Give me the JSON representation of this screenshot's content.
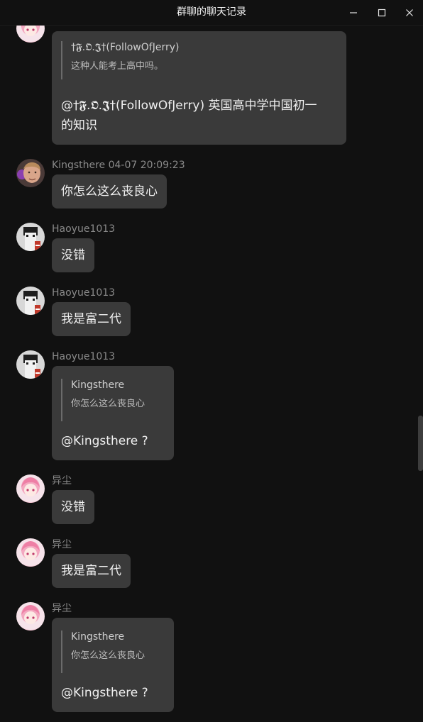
{
  "window": {
    "title": "群聊的聊天记录"
  },
  "messages": {
    "m0": {
      "quote": {
        "name": "†𝕱.𝕺.𝕵†(FollowOfJerry)",
        "text": "这种人能考上高中吗。"
      },
      "reply_line1": "@†𝕱.𝕺.𝕵†(FollowOfJerry) 英国高中学中国初一",
      "reply_line2": "的知识"
    },
    "m1": {
      "sender": "Kingsthere 04-07 20:09:23",
      "text": "你怎么这么丧良心"
    },
    "m2": {
      "sender": "Haoyue1013",
      "text": "没错"
    },
    "m3": {
      "sender": "Haoyue1013",
      "text": "我是富二代"
    },
    "m4": {
      "sender": "Haoyue1013",
      "quote": {
        "name": "Kingsthere",
        "text": "你怎么这么丧良心"
      },
      "reply": "@Kingsthere ?"
    },
    "m5": {
      "sender": "异尘",
      "text": "没错"
    },
    "m6": {
      "sender": "异尘",
      "text": "我是富二代"
    },
    "m7": {
      "sender": "异尘",
      "quote": {
        "name": "Kingsthere",
        "text": "你怎么这么丧良心"
      },
      "reply": "@Kingsthere ?"
    }
  },
  "avatars": {
    "anime": "anime-girl-avatar",
    "photo": "man-photo-avatar",
    "pixel": "pixel-character-avatar"
  },
  "colors": {
    "background": "#111111",
    "bubble": "#3a3a3a",
    "meta_text": "#8a8a8a"
  }
}
